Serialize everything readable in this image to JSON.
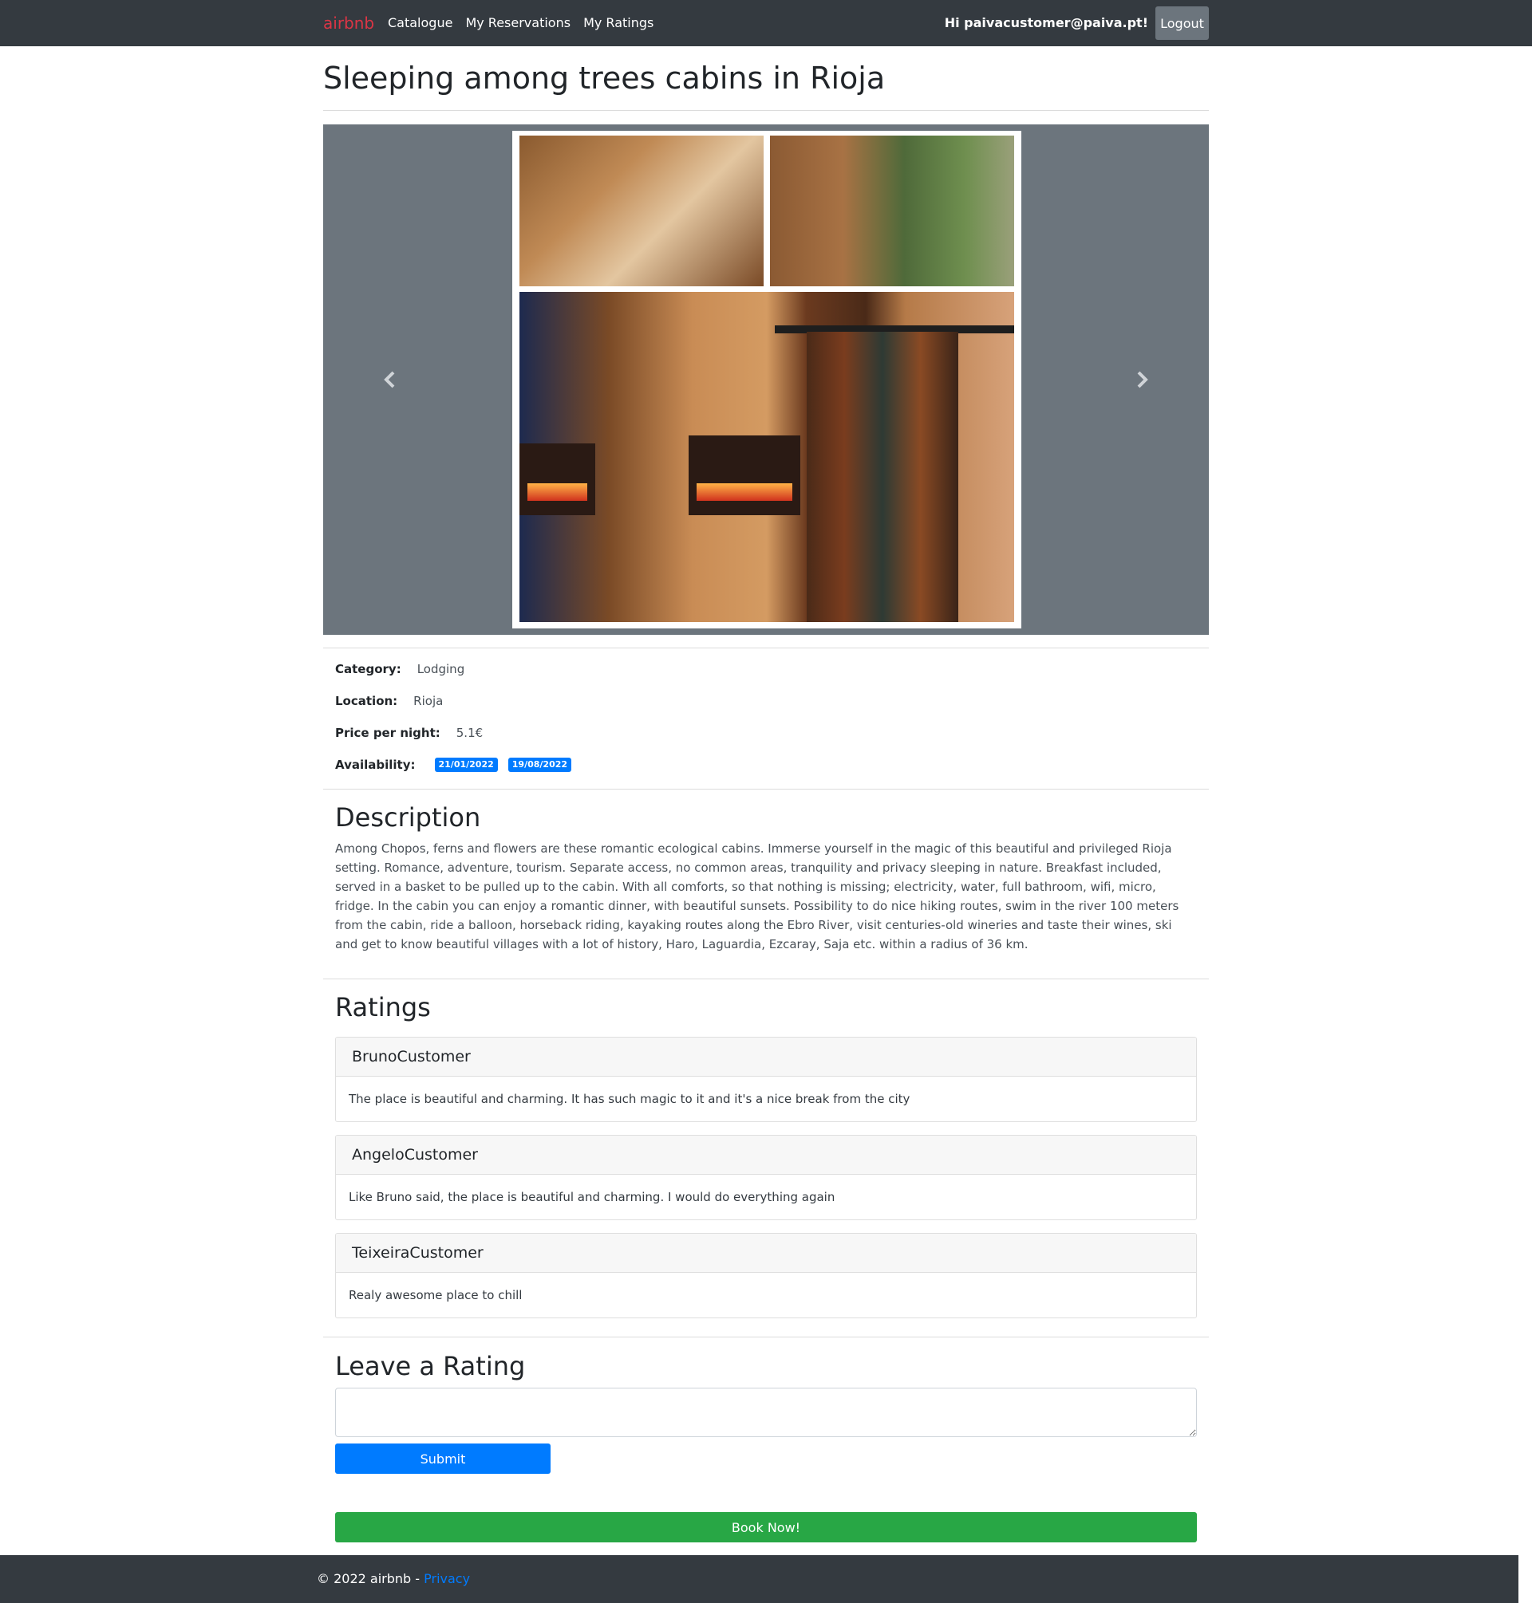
{
  "nav": {
    "brand": "airbnb",
    "links": [
      "Catalogue",
      "My Reservations",
      "My Ratings"
    ],
    "greeting": "Hi paivacustomer@paiva.pt!",
    "logout_label": "Logout"
  },
  "listing": {
    "title": "Sleeping among trees cabins in Rioja",
    "category_label": "Category:",
    "category": "Lodging",
    "location_label": "Location:",
    "location": "Rioja",
    "price_label": "Price per night:",
    "price": "5.1€",
    "availability_label": "Availability:",
    "availability": [
      "21/01/2022",
      "19/08/2022"
    ]
  },
  "carousel": {
    "prev_icon": "chevron-left-icon",
    "next_icon": "chevron-right-icon"
  },
  "description": {
    "heading": "Description",
    "text": "Among Chopos, ferns and flowers are these romantic ecological cabins. Immerse yourself in the magic of this beautiful and privileged Rioja setting. Romance, adventure, tourism. Separate access, no common areas, tranquility and privacy sleeping in nature. Breakfast included, served in a basket to be pulled up to the cabin. With all comforts, so that nothing is missing; electricity, water, full bathroom, wifi, micro, fridge. In the cabin you can enjoy a romantic dinner, with beautiful sunsets. Possibility to do nice hiking routes, swim in the river 100 meters from the cabin, ride a balloon, horseback riding, kayaking routes along the Ebro River, visit centuries-old wineries and taste their wines, ski and get to know beautiful villages with a lot of history, Haro, Laguardia, Ezcaray, Saja etc. within a radius of 36 km."
  },
  "ratings": {
    "heading": "Ratings",
    "items": [
      {
        "user": "BrunoCustomer",
        "comment": "The place is beautiful and charming. It has such magic to it and it's a nice break from the city"
      },
      {
        "user": "AngeloCustomer",
        "comment": "Like Bruno said, the place is beautiful and charming. I would do everything again"
      },
      {
        "user": "TeixeiraCustomer",
        "comment": "Realy awesome place to chill"
      }
    ]
  },
  "leave_rating": {
    "heading": "Leave a Rating",
    "textarea_value": "",
    "submit_label": "Submit"
  },
  "book_label": "Book Now!",
  "footer": {
    "text": "© 2022 airbnb - ",
    "privacy_label": "Privacy"
  },
  "colors": {
    "navbar_bg": "#343a40",
    "brand": "#dc3545",
    "primary": "#007bff",
    "success": "#28a745",
    "carousel_bg": "#6c757d"
  }
}
